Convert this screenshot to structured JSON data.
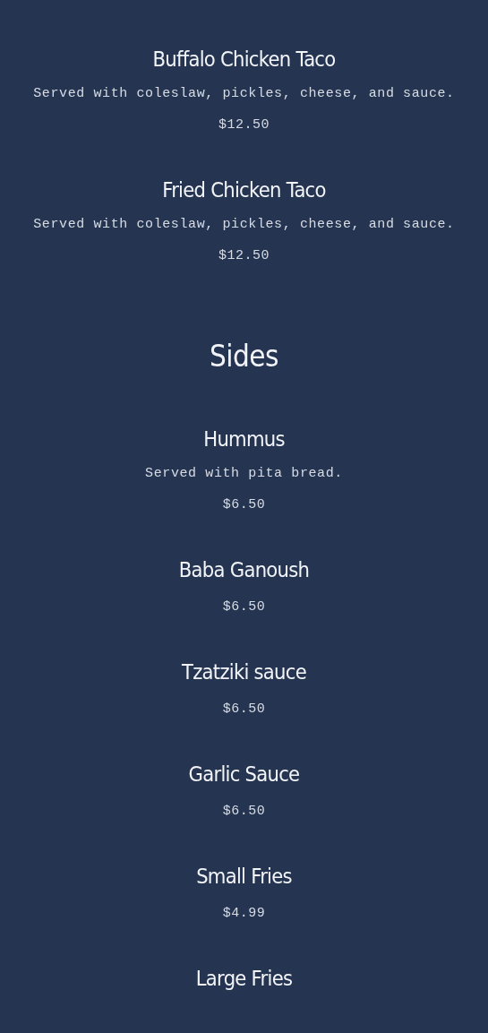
{
  "sections": [
    {
      "items": [
        {
          "name": "Buffalo Chicken Taco",
          "description": "Served with coleslaw, pickles, cheese, and sauce.",
          "price": "$12.50"
        },
        {
          "name": "Fried Chicken Taco",
          "description": "Served with coleslaw, pickles, cheese, and sauce.",
          "price": "$12.50"
        }
      ]
    },
    {
      "heading": "Sides",
      "items": [
        {
          "name": "Hummus",
          "description": "Served with pita bread.",
          "price": "$6.50"
        },
        {
          "name": "Baba Ganoush",
          "price": "$6.50"
        },
        {
          "name": "Tzatziki sauce",
          "price": "$6.50"
        },
        {
          "name": "Garlic Sauce",
          "price": "$6.50"
        },
        {
          "name": "Small Fries",
          "price": "$4.99"
        },
        {
          "name": "Large Fries"
        }
      ]
    }
  ]
}
